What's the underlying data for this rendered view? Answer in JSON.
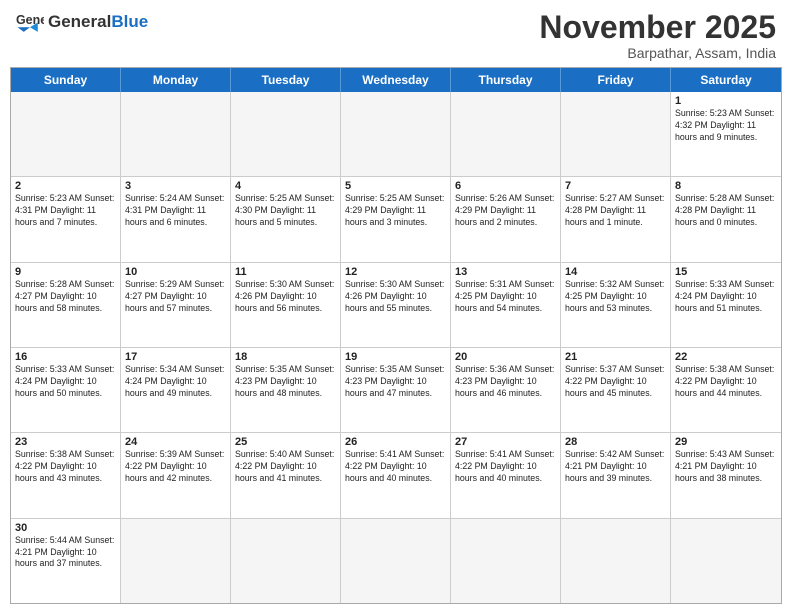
{
  "header": {
    "logo_general": "General",
    "logo_blue": "Blue",
    "month_title": "November 2025",
    "location": "Barpathar, Assam, India"
  },
  "weekdays": [
    "Sunday",
    "Monday",
    "Tuesday",
    "Wednesday",
    "Thursday",
    "Friday",
    "Saturday"
  ],
  "rows": [
    [
      {
        "day": "",
        "info": ""
      },
      {
        "day": "",
        "info": ""
      },
      {
        "day": "",
        "info": ""
      },
      {
        "day": "",
        "info": ""
      },
      {
        "day": "",
        "info": ""
      },
      {
        "day": "",
        "info": ""
      },
      {
        "day": "1",
        "info": "Sunrise: 5:23 AM\nSunset: 4:32 PM\nDaylight: 11 hours\nand 9 minutes."
      }
    ],
    [
      {
        "day": "2",
        "info": "Sunrise: 5:23 AM\nSunset: 4:31 PM\nDaylight: 11 hours\nand 7 minutes."
      },
      {
        "day": "3",
        "info": "Sunrise: 5:24 AM\nSunset: 4:31 PM\nDaylight: 11 hours\nand 6 minutes."
      },
      {
        "day": "4",
        "info": "Sunrise: 5:25 AM\nSunset: 4:30 PM\nDaylight: 11 hours\nand 5 minutes."
      },
      {
        "day": "5",
        "info": "Sunrise: 5:25 AM\nSunset: 4:29 PM\nDaylight: 11 hours\nand 3 minutes."
      },
      {
        "day": "6",
        "info": "Sunrise: 5:26 AM\nSunset: 4:29 PM\nDaylight: 11 hours\nand 2 minutes."
      },
      {
        "day": "7",
        "info": "Sunrise: 5:27 AM\nSunset: 4:28 PM\nDaylight: 11 hours\nand 1 minute."
      },
      {
        "day": "8",
        "info": "Sunrise: 5:28 AM\nSunset: 4:28 PM\nDaylight: 11 hours\nand 0 minutes."
      }
    ],
    [
      {
        "day": "9",
        "info": "Sunrise: 5:28 AM\nSunset: 4:27 PM\nDaylight: 10 hours\nand 58 minutes."
      },
      {
        "day": "10",
        "info": "Sunrise: 5:29 AM\nSunset: 4:27 PM\nDaylight: 10 hours\nand 57 minutes."
      },
      {
        "day": "11",
        "info": "Sunrise: 5:30 AM\nSunset: 4:26 PM\nDaylight: 10 hours\nand 56 minutes."
      },
      {
        "day": "12",
        "info": "Sunrise: 5:30 AM\nSunset: 4:26 PM\nDaylight: 10 hours\nand 55 minutes."
      },
      {
        "day": "13",
        "info": "Sunrise: 5:31 AM\nSunset: 4:25 PM\nDaylight: 10 hours\nand 54 minutes."
      },
      {
        "day": "14",
        "info": "Sunrise: 5:32 AM\nSunset: 4:25 PM\nDaylight: 10 hours\nand 53 minutes."
      },
      {
        "day": "15",
        "info": "Sunrise: 5:33 AM\nSunset: 4:24 PM\nDaylight: 10 hours\nand 51 minutes."
      }
    ],
    [
      {
        "day": "16",
        "info": "Sunrise: 5:33 AM\nSunset: 4:24 PM\nDaylight: 10 hours\nand 50 minutes."
      },
      {
        "day": "17",
        "info": "Sunrise: 5:34 AM\nSunset: 4:24 PM\nDaylight: 10 hours\nand 49 minutes."
      },
      {
        "day": "18",
        "info": "Sunrise: 5:35 AM\nSunset: 4:23 PM\nDaylight: 10 hours\nand 48 minutes."
      },
      {
        "day": "19",
        "info": "Sunrise: 5:35 AM\nSunset: 4:23 PM\nDaylight: 10 hours\nand 47 minutes."
      },
      {
        "day": "20",
        "info": "Sunrise: 5:36 AM\nSunset: 4:23 PM\nDaylight: 10 hours\nand 46 minutes."
      },
      {
        "day": "21",
        "info": "Sunrise: 5:37 AM\nSunset: 4:22 PM\nDaylight: 10 hours\nand 45 minutes."
      },
      {
        "day": "22",
        "info": "Sunrise: 5:38 AM\nSunset: 4:22 PM\nDaylight: 10 hours\nand 44 minutes."
      }
    ],
    [
      {
        "day": "23",
        "info": "Sunrise: 5:38 AM\nSunset: 4:22 PM\nDaylight: 10 hours\nand 43 minutes."
      },
      {
        "day": "24",
        "info": "Sunrise: 5:39 AM\nSunset: 4:22 PM\nDaylight: 10 hours\nand 42 minutes."
      },
      {
        "day": "25",
        "info": "Sunrise: 5:40 AM\nSunset: 4:22 PM\nDaylight: 10 hours\nand 41 minutes."
      },
      {
        "day": "26",
        "info": "Sunrise: 5:41 AM\nSunset: 4:22 PM\nDaylight: 10 hours\nand 40 minutes."
      },
      {
        "day": "27",
        "info": "Sunrise: 5:41 AM\nSunset: 4:22 PM\nDaylight: 10 hours\nand 40 minutes."
      },
      {
        "day": "28",
        "info": "Sunrise: 5:42 AM\nSunset: 4:21 PM\nDaylight: 10 hours\nand 39 minutes."
      },
      {
        "day": "29",
        "info": "Sunrise: 5:43 AM\nSunset: 4:21 PM\nDaylight: 10 hours\nand 38 minutes."
      }
    ],
    [
      {
        "day": "30",
        "info": "Sunrise: 5:44 AM\nSunset: 4:21 PM\nDaylight: 10 hours\nand 37 minutes."
      },
      {
        "day": "",
        "info": ""
      },
      {
        "day": "",
        "info": ""
      },
      {
        "day": "",
        "info": ""
      },
      {
        "day": "",
        "info": ""
      },
      {
        "day": "",
        "info": ""
      },
      {
        "day": "",
        "info": ""
      }
    ]
  ]
}
